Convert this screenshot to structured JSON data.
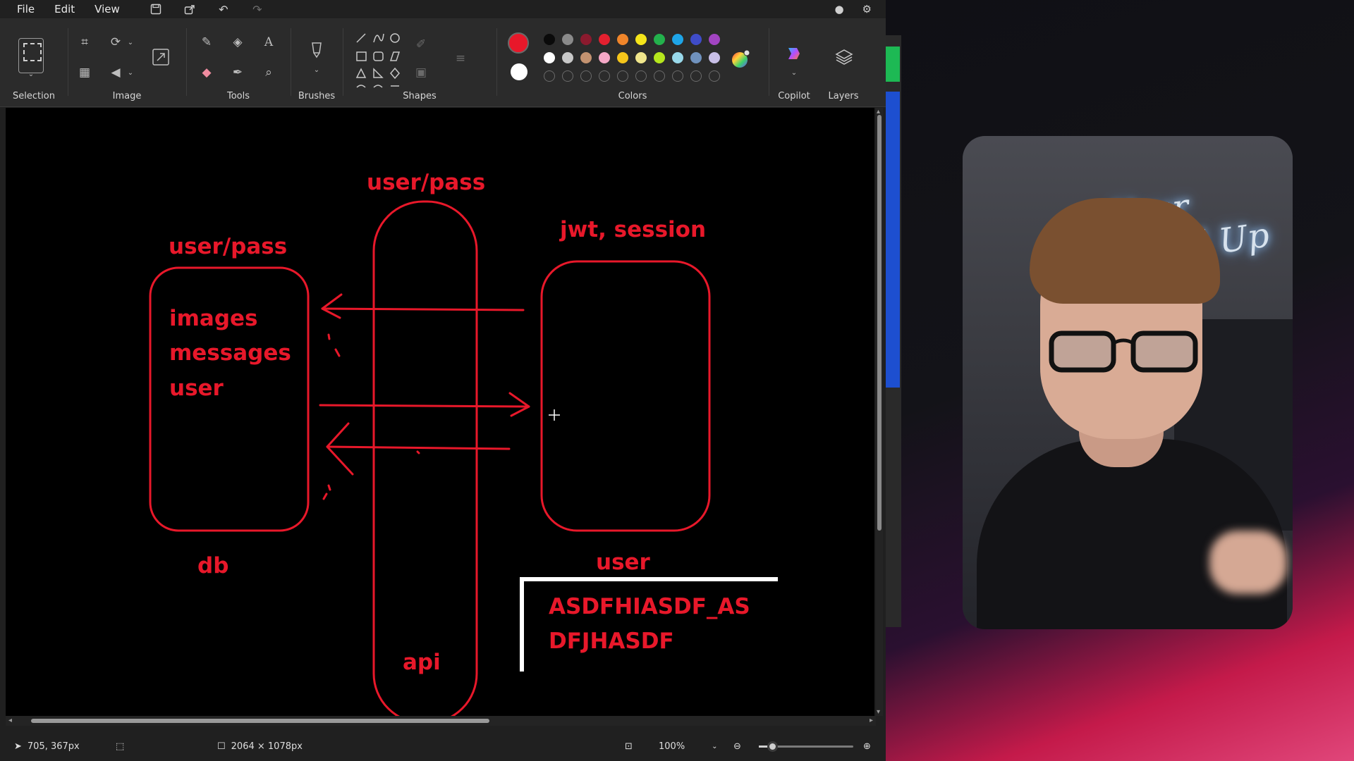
{
  "menu": {
    "items": [
      "File",
      "Edit",
      "View"
    ]
  },
  "ribbon": {
    "groups": {
      "selection": "Selection",
      "image": "Image",
      "tools": "Tools",
      "brushes": "Brushes",
      "shapes": "Shapes",
      "colors": "Colors",
      "copilot": "Copilot",
      "layers": "Layers"
    },
    "palette": {
      "primary": "#e8182a",
      "secondary": "#ffffff",
      "row1": [
        "#0a0a0a",
        "#8a8a8a",
        "#8b1a2e",
        "#e3202f",
        "#f0852a",
        "#f5e51a",
        "#23b14c",
        "#1ea5e8",
        "#3f4cc9",
        "#a244c2"
      ],
      "row2": [
        "#ffffff",
        "#c8c8c8",
        "#c39270",
        "#f5a8c6",
        "#f5c51a",
        "#f0e68c",
        "#b5e61d",
        "#99d9ea",
        "#7092be",
        "#c8bfe7"
      ]
    }
  },
  "drawing": {
    "label_user_pass_left": "user/pass",
    "label_user_pass_top": "user/pass",
    "label_jwt": "jwt, session",
    "db_line1": "images",
    "db_line2": "messages",
    "db_line3": "user",
    "label_db": "db",
    "label_api": "api",
    "label_user": "user",
    "token_line1": "ASDFHIASDF_AS",
    "token_line2": "DFJHASDF",
    "ink_color": "#e8182a"
  },
  "status": {
    "cursor_position": "705, 367px",
    "canvas_size": "2064 × 1078px",
    "zoom": "100%"
  },
  "webcam": {
    "neon_sign": "Your Level Up"
  }
}
